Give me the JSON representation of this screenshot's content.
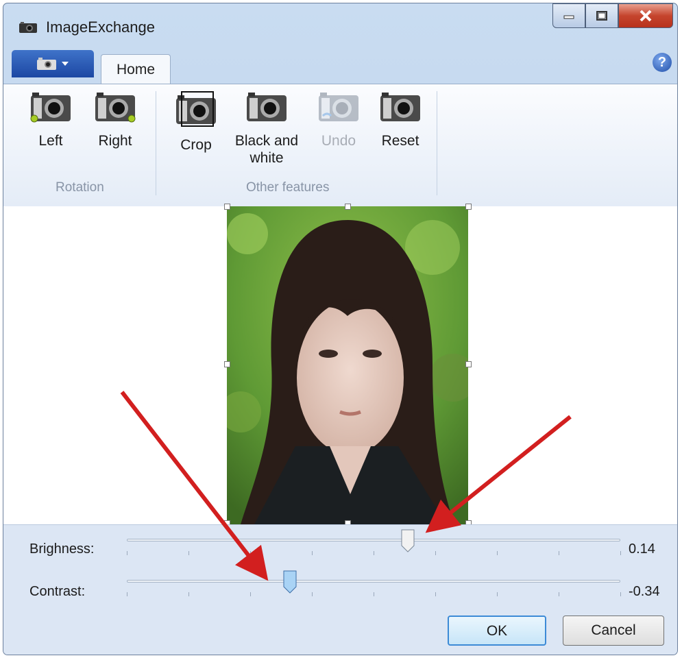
{
  "window": {
    "title": "ImageExchange",
    "controls": {
      "minimize": "minimize-icon",
      "maximize": "maximize-icon",
      "close": "close-icon"
    }
  },
  "ribbon": {
    "app_menu": "camera-icon",
    "tabs": [
      {
        "label": "Home",
        "selected": true
      }
    ],
    "help": "?",
    "groups": [
      {
        "label": "Rotation",
        "buttons": [
          {
            "label": "Left",
            "icon": "rotate-left-camera-icon",
            "enabled": true
          },
          {
            "label": "Right",
            "icon": "rotate-right-camera-icon",
            "enabled": true
          }
        ]
      },
      {
        "label": "Other features",
        "buttons": [
          {
            "label": "Crop",
            "icon": "crop-camera-icon",
            "enabled": true,
            "line2": ""
          },
          {
            "label": "Black and",
            "line2": "white",
            "icon": "black-white-camera-icon",
            "enabled": true
          },
          {
            "label": "Undo",
            "icon": "undo-camera-icon",
            "enabled": false
          },
          {
            "label": "Reset",
            "icon": "reset-camera-icon",
            "enabled": true
          }
        ]
      }
    ]
  },
  "adjustments": {
    "brightness": {
      "label": "Brighness:",
      "value_text": "0.14",
      "value": 0.14,
      "min": -1,
      "max": 1
    },
    "contrast": {
      "label": "Contrast:",
      "value_text": "-0.34",
      "value": -0.34,
      "min": -1,
      "max": 1
    }
  },
  "buttons": {
    "ok": "OK",
    "cancel": "Cancel"
  },
  "colors": {
    "accent": "#3c8ad6",
    "arrow": "#d21f1f",
    "app_menu": "#1f4ea8",
    "close": "#c5452e"
  }
}
